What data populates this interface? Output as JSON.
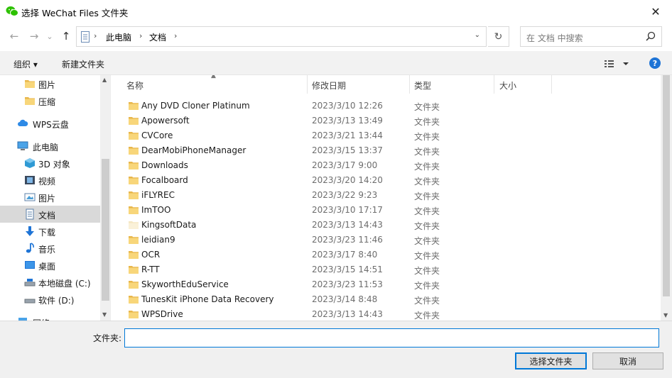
{
  "window": {
    "title": "选择 WeChat Files 文件夹",
    "close_glyph": "✕"
  },
  "nav": {
    "back_glyph": "←",
    "forward_glyph": "→",
    "recent_glyph": "⌄",
    "up_glyph": "↑",
    "breadcrumb": [
      "此电脑",
      "文档"
    ],
    "chevron": "›",
    "dropdown_glyph": "⌄",
    "refresh_glyph": "↻",
    "search_placeholder": "在 文档 中搜索"
  },
  "toolbar": {
    "organize": "组织 ▾",
    "new_folder": "新建文件夹",
    "help": "?"
  },
  "sidebar": {
    "items": [
      {
        "label": "图片",
        "icon": "folder-icon"
      },
      {
        "label": "压缩",
        "icon": "folder-icon"
      },
      {
        "label": "WPS云盘",
        "icon": "cloud-icon"
      },
      {
        "label": "此电脑",
        "icon": "computer-icon"
      },
      {
        "label": "3D 对象",
        "icon": "3d-objects-icon"
      },
      {
        "label": "视频",
        "icon": "video-icon"
      },
      {
        "label": "图片",
        "icon": "pictures-icon"
      },
      {
        "label": "文档",
        "icon": "documents-icon"
      },
      {
        "label": "下载",
        "icon": "download-icon"
      },
      {
        "label": "音乐",
        "icon": "music-icon"
      },
      {
        "label": "桌面",
        "icon": "desktop-icon"
      },
      {
        "label": "本地磁盘 (C:)",
        "icon": "drive-icon"
      },
      {
        "label": "软件 (D:)",
        "icon": "drive-icon"
      },
      {
        "label": "网络",
        "icon": "network-icon"
      }
    ]
  },
  "columns": {
    "name": "名称",
    "date": "修改日期",
    "type": "类型",
    "size": "大小"
  },
  "files": [
    {
      "name": "Any DVD Cloner Platinum",
      "date": "2023/3/10 12:26",
      "type": "文件夹"
    },
    {
      "name": "Apowersoft",
      "date": "2023/3/13 13:49",
      "type": "文件夹"
    },
    {
      "name": "CVCore",
      "date": "2023/3/21 13:44",
      "type": "文件夹"
    },
    {
      "name": "DearMobiPhoneManager",
      "date": "2023/3/15 13:37",
      "type": "文件夹"
    },
    {
      "name": "Downloads",
      "date": "2023/3/17 9:00",
      "type": "文件夹"
    },
    {
      "name": "Focalboard",
      "date": "2023/3/20 14:20",
      "type": "文件夹"
    },
    {
      "name": "iFLYREC",
      "date": "2023/3/22 9:23",
      "type": "文件夹"
    },
    {
      "name": "ImTOO",
      "date": "2023/3/10 17:17",
      "type": "文件夹"
    },
    {
      "name": "KingsoftData",
      "date": "2023/3/13 14:43",
      "type": "文件夹"
    },
    {
      "name": "leidian9",
      "date": "2023/3/23 11:46",
      "type": "文件夹"
    },
    {
      "name": "OCR",
      "date": "2023/3/17 8:40",
      "type": "文件夹"
    },
    {
      "name": "R-TT",
      "date": "2023/3/15 14:51",
      "type": "文件夹"
    },
    {
      "name": "SkyworthEduService",
      "date": "2023/3/23 11:53",
      "type": "文件夹"
    },
    {
      "name": "TunesKit iPhone Data Recovery",
      "date": "2023/3/14 8:48",
      "type": "文件夹"
    },
    {
      "name": "WPSDrive",
      "date": "2023/3/13 14:43",
      "type": "文件夹"
    }
  ],
  "footer": {
    "folder_label": "文件夹:",
    "folder_value": "",
    "select_button": "选择文件夹",
    "cancel_button": "取消"
  },
  "colors": {
    "accent": "#0078d7",
    "folder": "#e8b64a",
    "selected_bg": "#d9d9d9"
  }
}
